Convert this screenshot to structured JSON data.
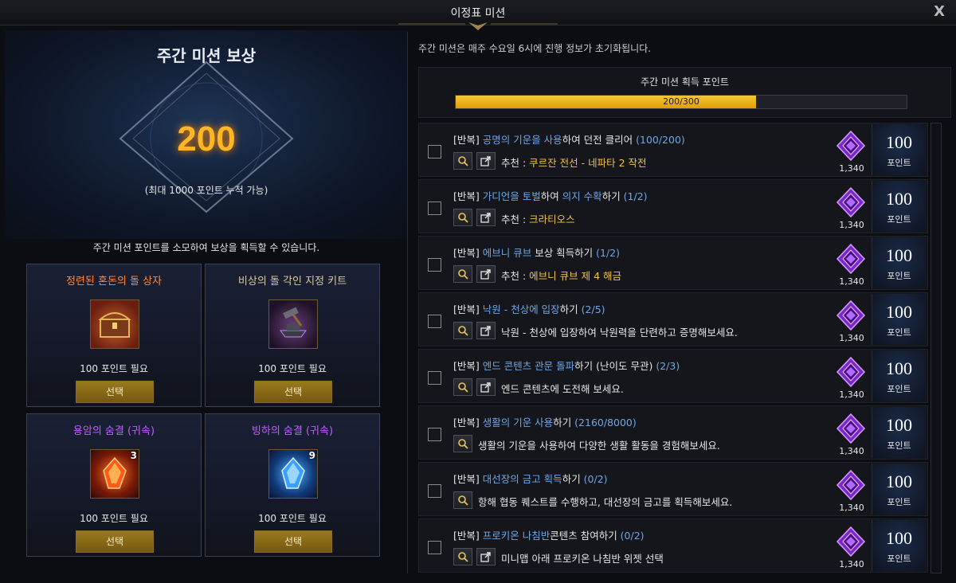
{
  "window": {
    "title": "이정표 미션",
    "close": "X"
  },
  "left": {
    "hero_title": "주간 미션 보상",
    "points": "200",
    "cap_text": "(최대 1000 포인트 누적 가능)",
    "description": "주간 미션 포인트를 소모하여 보상을 획득할 수 있습니다.",
    "rewards": [
      {
        "name": "정련된 혼돈의 돌 상자",
        "name_color": "#ff8a3d",
        "icon": "treasure-chest-icon",
        "qty": "",
        "cost": "100 포인트 필요",
        "button": "선택"
      },
      {
        "name": "비상의 돌 각인 지정 키트",
        "name_color": "#d6c9a2",
        "icon": "anvil-hammer-icon",
        "qty": "",
        "cost": "100 포인트 필요",
        "button": "선택"
      },
      {
        "name": "용암의 숨결 (귀속)",
        "name_color": "#c25bff",
        "icon": "lava-crystal-icon",
        "qty": "3",
        "cost": "100 포인트 필요",
        "button": "선택"
      },
      {
        "name": "빙하의 숨결 (귀속)",
        "name_color": "#c25bff",
        "icon": "ice-crystal-icon",
        "qty": "9",
        "cost": "100 포인트 필요",
        "button": "선택"
      }
    ]
  },
  "right": {
    "description": "주간 미션은 매주 수요일 6시에 진행 정보가 초기화됩니다.",
    "progress": {
      "label": "주간 미션 획득 포인트",
      "text": "200/300",
      "value": 200,
      "max": 300
    },
    "missions": [
      {
        "tag": "[반복]",
        "parts": [
          [
            "공명의 기운을 사용",
            true
          ],
          [
            "하여 던전 클리어",
            false
          ]
        ],
        "progress": "(100/200)",
        "has_share": true,
        "detail_prefix": "추천 : ",
        "detail": "쿠르잔 전선 - 네파타 2 작전",
        "gem_count": "1,340",
        "reward": "100",
        "reward_unit": "포인트"
      },
      {
        "tag": "[반복]",
        "parts": [
          [
            "가디언을 토벌",
            true
          ],
          [
            "하여 ",
            false
          ],
          [
            "의지 수확",
            true
          ],
          [
            "하기",
            false
          ]
        ],
        "progress": "(1/2)",
        "has_share": true,
        "detail_prefix": "추천 : ",
        "detail": "크라티오스",
        "gem_count": "1,340",
        "reward": "100",
        "reward_unit": "포인트"
      },
      {
        "tag": "[반복]",
        "parts": [
          [
            "에브니 큐브",
            true
          ],
          [
            " 보상 획득하기",
            false
          ]
        ],
        "progress": "(1/2)",
        "has_share": true,
        "detail_prefix": "추천 : ",
        "detail": "에브니 큐브 제 4 해금",
        "gem_count": "1,340",
        "reward": "100",
        "reward_unit": "포인트"
      },
      {
        "tag": "[반복]",
        "parts": [
          [
            "낙원 - 천상에 입장",
            true
          ],
          [
            "하기",
            false
          ]
        ],
        "progress": "(2/5)",
        "has_share": true,
        "detail_prefix": "",
        "detail": "낙원 - 천상에 입장하여 낙원력을 단련하고 증명해보세요.",
        "gem_count": "1,340",
        "reward": "100",
        "reward_unit": "포인트"
      },
      {
        "tag": "[반복]",
        "parts": [
          [
            "엔드 콘텐츠 관문 돌파",
            true
          ],
          [
            "하기 (난이도 무관)",
            false
          ]
        ],
        "progress": "(2/3)",
        "has_share": true,
        "detail_prefix": "",
        "detail": "엔드 콘텐츠에 도전해 보세요.",
        "gem_count": "1,340",
        "reward": "100",
        "reward_unit": "포인트"
      },
      {
        "tag": "[반복]",
        "parts": [
          [
            "생활의 기운 사용",
            true
          ],
          [
            "하기",
            false
          ]
        ],
        "progress": "(2160/8000)",
        "has_share": false,
        "detail_prefix": "",
        "detail": "생활의 기운을 사용하여 다양한 생활 활동을 경험해보세요.",
        "gem_count": "1,340",
        "reward": "100",
        "reward_unit": "포인트"
      },
      {
        "tag": "[반복]",
        "parts": [
          [
            "대선장의 금고 획득",
            true
          ],
          [
            "하기",
            false
          ]
        ],
        "progress": "(0/2)",
        "has_share": false,
        "detail_prefix": "",
        "detail": "항해 협동 퀘스트를 수행하고, 대선장의 금고를 획득해보세요.",
        "gem_count": "1,340",
        "reward": "100",
        "reward_unit": "포인트"
      },
      {
        "tag": "[반복]",
        "parts": [
          [
            "프로키온 나침반",
            true
          ],
          [
            "콘텐츠 참여하기",
            false
          ]
        ],
        "progress": "(0/2)",
        "has_share": true,
        "detail_prefix": "",
        "detail": "미니맵 아래 프로키온 나침반 위젯 선택",
        "gem_count": "1,340",
        "reward": "100",
        "reward_unit": "포인트"
      }
    ]
  }
}
